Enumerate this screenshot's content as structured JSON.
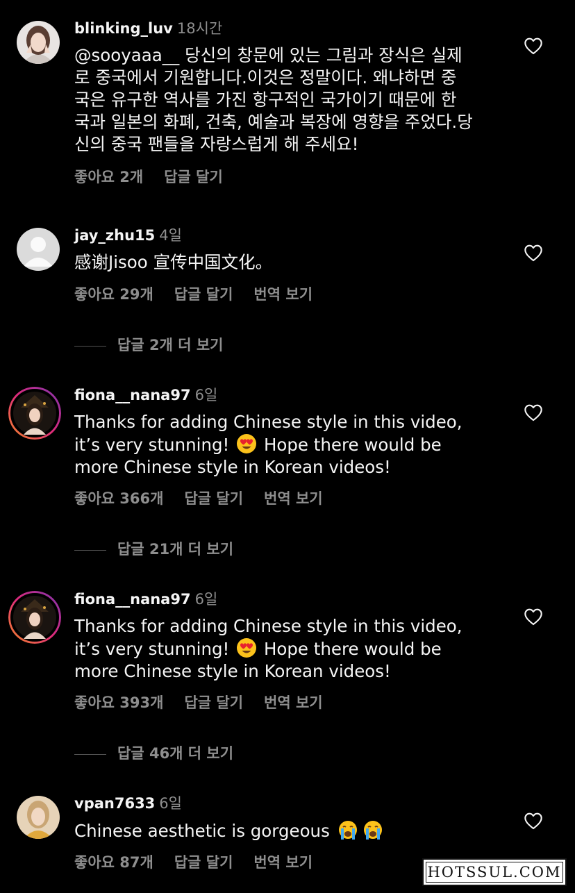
{
  "comments": [
    {
      "username": "blinking_luv",
      "time": "18시간",
      "lines": [
        "@sooyaaa__  당신의 창문에 있는 그림과 장식은 실제",
        "로 중국에서 기원합니다.이것은 정말이다. 왜냐하면 중",
        "국은 유구한 역사를 가진 항구적인 국가이기 때문에 한",
        "국과 일본의 화폐, 건축, 예술과 복장에 영향을 주었다.당",
        "신의 중국 팬들을 자랑스럽게 해 주세요!"
      ],
      "likes": "좋아요 2개",
      "reply": "답글 달기"
    },
    {
      "username": "jay_zhu15",
      "time": "4일",
      "lines": [
        "感谢Jisoo 宣传中国文化。"
      ],
      "likes": "좋아요 29개",
      "reply": "답글 달기",
      "translate": "번역 보기",
      "more_replies": "답글 2개 더 보기"
    },
    {
      "username": "fiona__nana97",
      "time": "6일",
      "line1": "Thanks for adding Chinese style in this video,",
      "line2_pre": "it’s very stunning!",
      "line2_post": "Hope there would be",
      "line3": "more Chinese style in Korean videos!",
      "likes": "좋아요 366개",
      "reply": "답글 달기",
      "translate": "번역 보기",
      "more_replies": "답글 21개 더 보기"
    },
    {
      "username": "fiona__nana97",
      "time": "6일",
      "line1": "Thanks for adding Chinese style in this video,",
      "line2_pre": "it’s very stunning!",
      "line2_post": "Hope there would be",
      "line3": "more Chinese style in Korean videos!",
      "likes": "좋아요 393개",
      "reply": "답글 달기",
      "translate": "번역 보기",
      "more_replies": "답글 46개 더 보기"
    },
    {
      "username": "vpan7633",
      "time": "6일",
      "text": "Chinese aesthetic is gorgeous",
      "likes": "좋아요 87개",
      "reply": "답글 달기",
      "translate": "번역 보기"
    }
  ],
  "icons": {
    "heart": "heart-outline-icon",
    "heart_eyes": "heart-eyes-emoji",
    "crying": "loudly-crying-emoji"
  },
  "watermark": "HOTSSUL.COM",
  "colors": {
    "background": "#000000",
    "primary_text": "#f5f5f5",
    "secondary_text": "#8e8e8e",
    "story_ring": "#c13584"
  }
}
